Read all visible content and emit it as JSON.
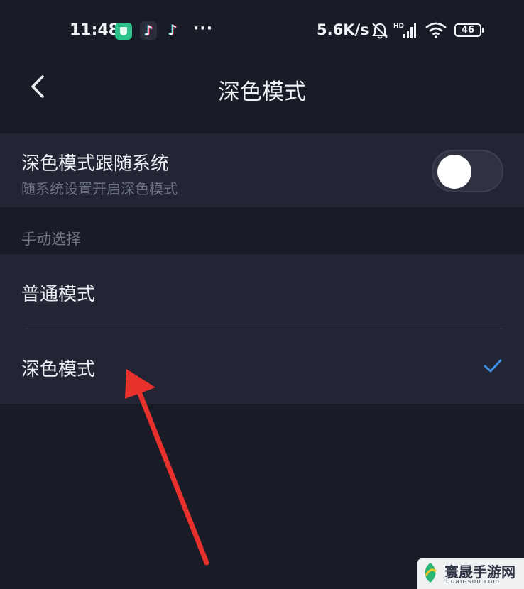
{
  "status_bar": {
    "time": "11:48",
    "dots": "···",
    "net_speed": "5.6K/s",
    "battery": "46",
    "icons": [
      "shield-app-icon",
      "tiktok-lite-icon",
      "tiktok-icon",
      "mute-bell-icon",
      "hd-signal-icon",
      "wifi-icon",
      "battery-icon"
    ]
  },
  "header": {
    "title": "深色模式",
    "back_icon": "chevron-left-icon"
  },
  "follow_system": {
    "title": "深色模式跟随系统",
    "subtitle": "随系统设置开启深色模式",
    "enabled": false
  },
  "manual": {
    "section_label": "手动选择",
    "options": [
      {
        "label": "普通模式",
        "selected": false
      },
      {
        "label": "深色模式",
        "selected": true
      }
    ]
  },
  "watermark": {
    "name": "寰晟手游网",
    "domain": "huan-sun.com"
  },
  "colors": {
    "background": "#191b26",
    "card": "#222533",
    "check": "#3d8ee8",
    "annotation_arrow": "#e8312d"
  }
}
